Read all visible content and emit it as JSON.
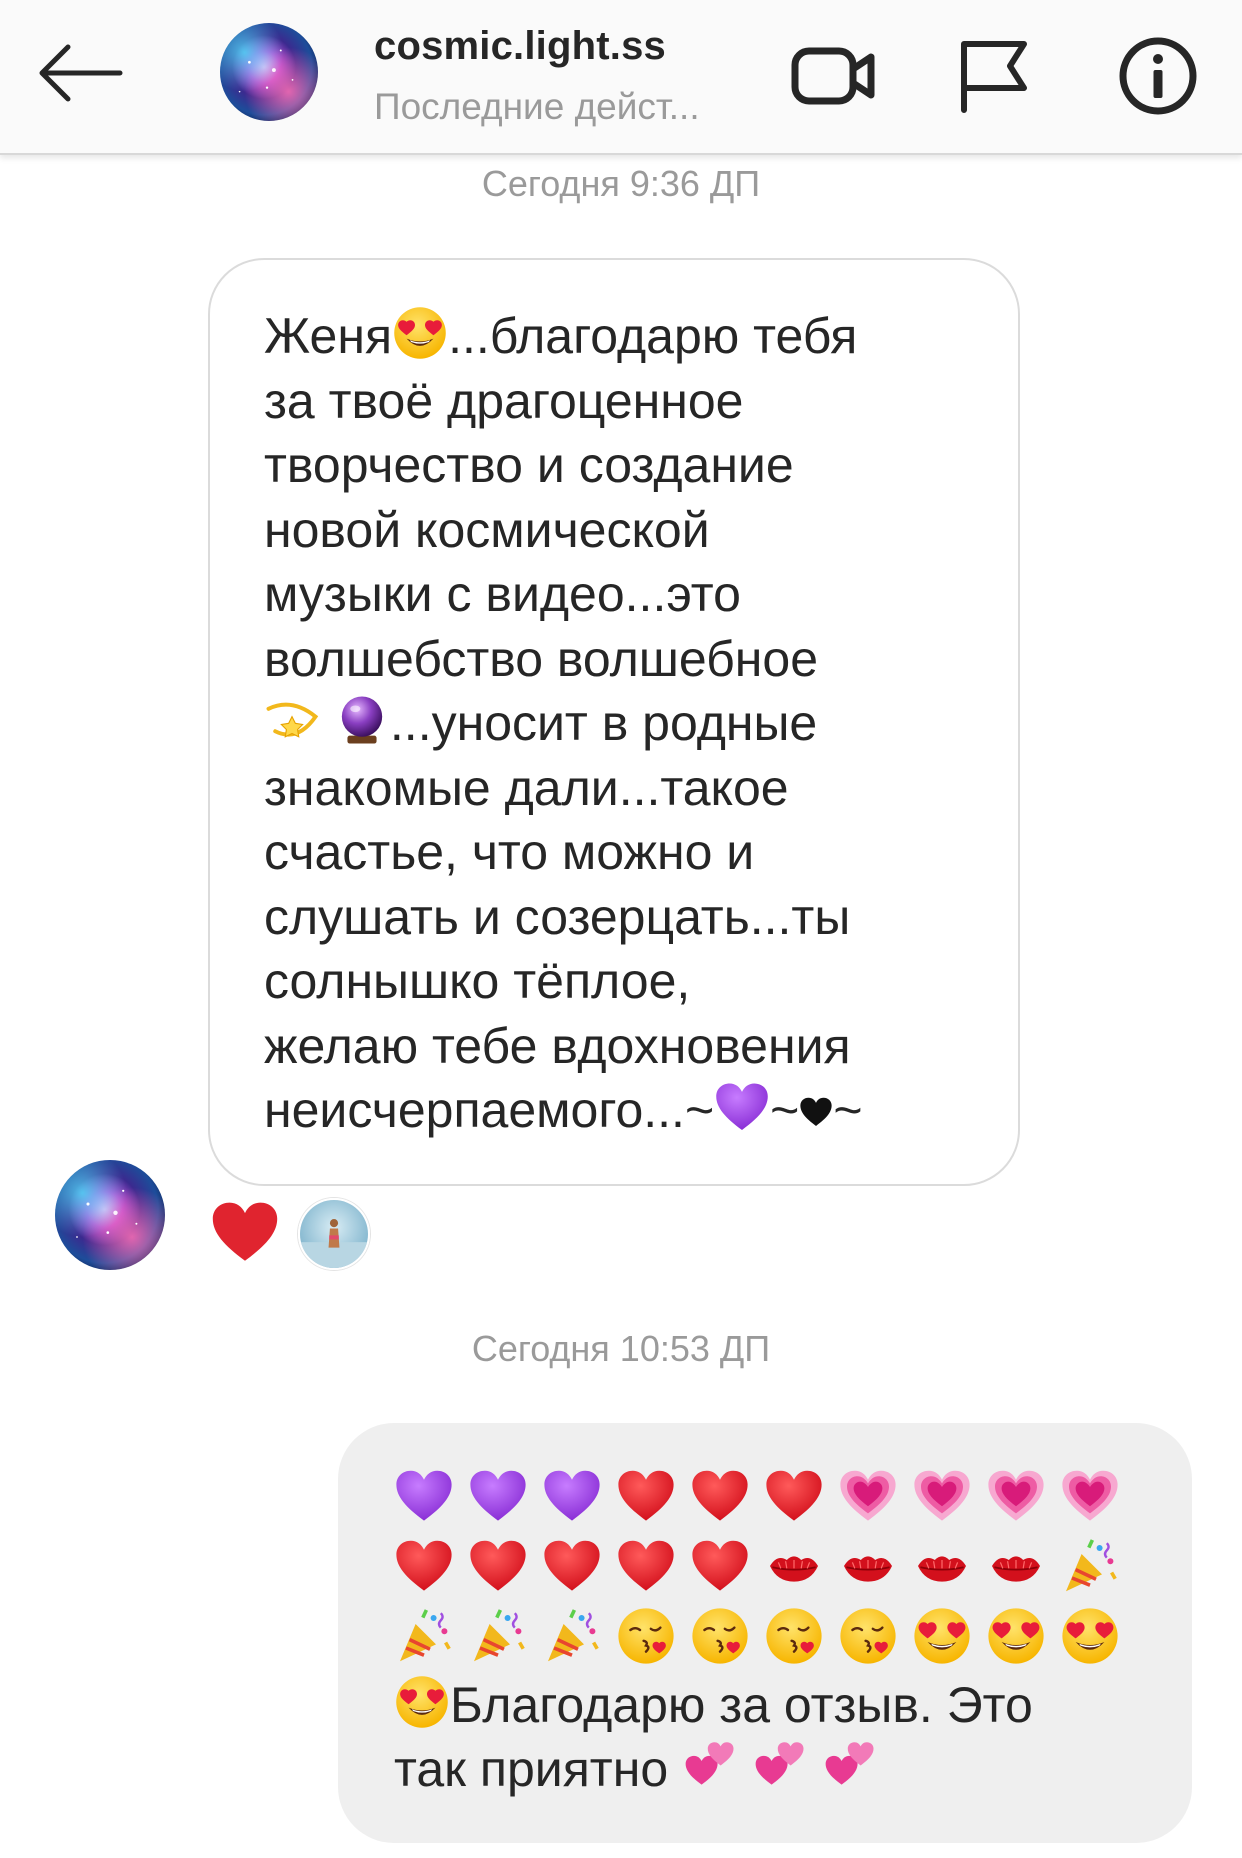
{
  "header": {
    "back_icon": "arrow-left-icon",
    "username": "cosmic.light.ss",
    "status": "Последние дейст...",
    "icons": [
      "video-camera-icon",
      "flag-icon",
      "info-icon"
    ]
  },
  "conversation": {
    "timestamp_1": "Сегодня 9:36 ДП",
    "incoming_message": {
      "lines": [
        "Женя",
        "...благодарю тебя",
        "за твоё драгоценное",
        "творчество и создание",
        "новой космической",
        "музыки с видео...это",
        "волшебство волшебное",
        "...уносит в родные",
        "знакомые дали...такое",
        "счастье, что можно и",
        "слушать и созерцать...ты",
        "солнышко тёплое,",
        "желаю тебе вдохновения",
        "неисчерпаемого...~",
        "~",
        "~"
      ],
      "emojis": [
        "heart-eyes-emoji",
        "dizzy-emoji",
        "crystal-ball-emoji",
        "purple-heart-emoji",
        "black-heart-emoji"
      ]
    },
    "reaction": {
      "emoji": "red-heart-emoji",
      "reactor_avatar": "reactor-avatar"
    },
    "timestamp_2": "Сегодня 10:53 ДП",
    "outgoing_message": {
      "emoji_rows": [
        [
          "purple-heart",
          "purple-heart",
          "purple-heart",
          "red-heart",
          "red-heart",
          "red-heart",
          "growing-heart",
          "growing-heart",
          "growing-heart",
          "growing-heart"
        ],
        [
          "red-heart",
          "red-heart",
          "red-heart",
          "red-heart",
          "red-heart",
          "kiss-mark",
          "kiss-mark",
          "kiss-mark",
          "kiss-mark",
          "party-popper"
        ],
        [
          "party-popper",
          "party-popper",
          "party-popper",
          "kissing-face",
          "kissing-face",
          "kissing-face",
          "kissing-face",
          "heart-eyes",
          "heart-eyes",
          "heart-eyes"
        ]
      ],
      "text_line_1": "Благодарю за отзыв. Это",
      "text_line_2": "так приятно",
      "trailing_emojis": [
        "two-hearts",
        "two-hearts",
        "two-hearts"
      ]
    }
  },
  "colors": {
    "header_bg": "#fafafa",
    "timestamp_gray": "#9a9a9a",
    "incoming_border": "#dbdbdb",
    "outgoing_bg": "#efefef",
    "heart_red": "#e0242f",
    "purple": "#9b3fe0"
  }
}
